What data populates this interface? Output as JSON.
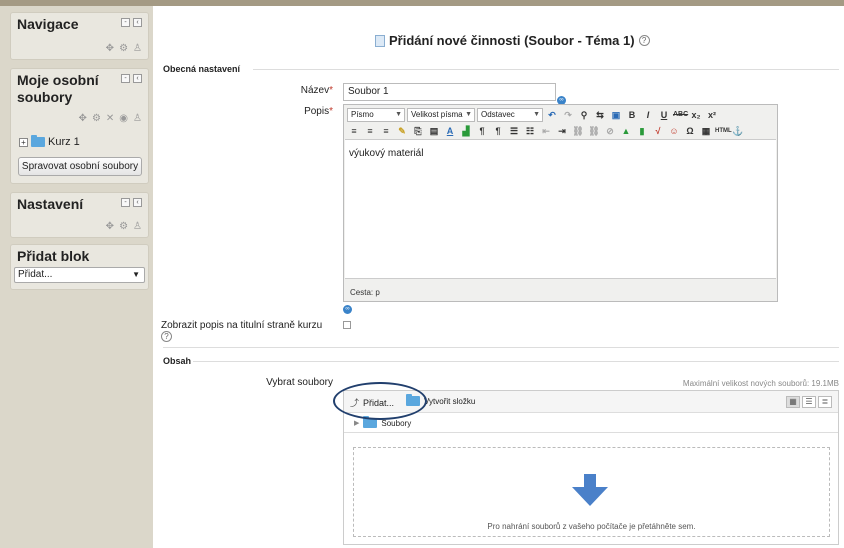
{
  "sidebar": {
    "navigation": {
      "title": "Navigace"
    },
    "private_files": {
      "title": "Moje osobní soubory",
      "tree_item": "Kurz 1",
      "manage_button": "Spravovat osobní soubory"
    },
    "settings": {
      "title": "Nastavení"
    },
    "add_block": {
      "title": "Přidat blok",
      "select_value": "Přidat..."
    }
  },
  "page": {
    "title": "Přidání nové činnosti (Soubor - Téma 1)"
  },
  "general": {
    "legend": "Obecná nastavení",
    "name_label": "Název",
    "name_value": "Soubor 1",
    "description_label": "Popis",
    "editor": {
      "font_select": "Písmo",
      "size_select": "Velikost písma",
      "format_select": "Odstavec",
      "content": "výukový materiál",
      "path": "Cesta: p"
    },
    "show_description_label": "Zobrazit popis na titulní straně kurzu"
  },
  "content": {
    "legend": "Obsah",
    "select_files_label": "Vybrat soubory",
    "max_size": "Maximální velikost nových souborů: 19.1MB",
    "add_button": "Přidat...",
    "create_folder": "Vytvořit složku",
    "folder_name": "Soubory",
    "drop_hint": "Pro nahrání souborů z vašeho počítače je přetáhněte sem."
  },
  "colors": {
    "sidebar_bg": "#dbd7ca",
    "required": "#c0392b",
    "accent": "#3a83c9",
    "circle": "#213f6d"
  },
  "icons": [
    "document-icon",
    "help-icon",
    "folder-icon",
    "link-icon",
    "down-arrow-icon",
    "gear-icon",
    "move-icon",
    "delete-icon",
    "dock-icon",
    "hide-icon"
  ]
}
